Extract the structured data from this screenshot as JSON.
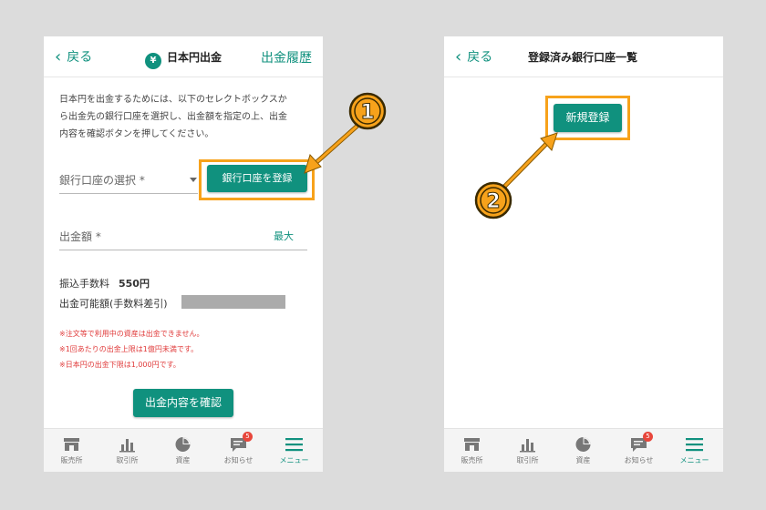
{
  "screen1": {
    "header": {
      "back_label": "戻る",
      "title_icon": "¥",
      "title": "日本円出金",
      "right_link": "出金履歴"
    },
    "description": [
      "日本円を出金するためには、以下のセレクトボックスか",
      "ら出金先の銀行口座を選択し、出金額を指定の上、出金",
      "内容を確認ボタンを押してください。"
    ],
    "bank_select": {
      "label": "銀行口座の選択 *"
    },
    "register_button": "銀行口座を登録",
    "amount": {
      "label": "出金額 *",
      "max_label": "最大"
    },
    "fee_label": "振込手数料",
    "fee_value": "550円",
    "available_label": "出金可能額(手数料差引)",
    "notes": [
      "※注文等で利用中の資産は出金できません。",
      "※1回あたりの出金上限は1億円未満です。",
      "※日本円の出金下限は1,000円です。"
    ],
    "confirm_button": "出金内容を確認"
  },
  "screen2": {
    "header": {
      "back_label": "戻る",
      "title": "登録済み銀行口座一覧"
    },
    "new_register_button": "新規登録"
  },
  "tabbar": {
    "tabs": [
      {
        "label": "販売所",
        "icon": "shop-icon"
      },
      {
        "label": "取引所",
        "icon": "bar-chart-icon"
      },
      {
        "label": "資産",
        "icon": "pie-chart-icon"
      },
      {
        "label": "お知らせ",
        "icon": "message-icon",
        "badge": "5"
      },
      {
        "label": "メニュー",
        "icon": "hamburger-menu-icon"
      }
    ]
  },
  "callouts": {
    "step1": "①",
    "step2": "②"
  },
  "colors": {
    "accent": "#10917e",
    "highlight": "#f7a21b",
    "warning_text": "#e03b3b",
    "badge": "#e8463b"
  }
}
